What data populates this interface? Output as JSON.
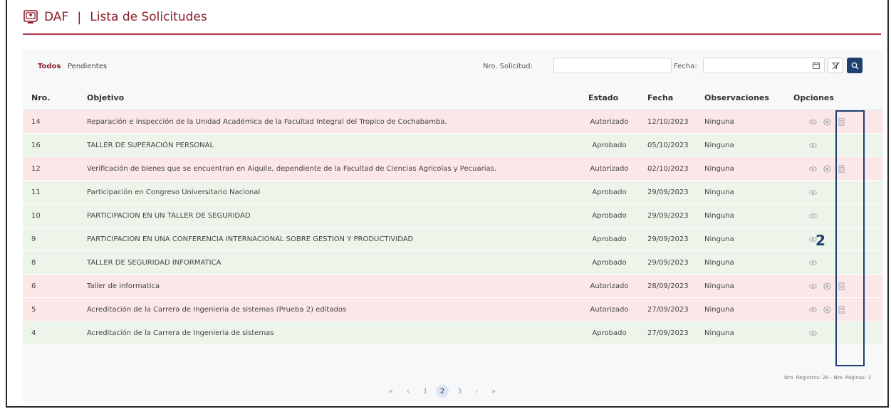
{
  "header": {
    "brand": "DAF",
    "separator": "|",
    "title": "Lista de Solicitudes"
  },
  "tabs": [
    {
      "label": "Todos",
      "active": true
    },
    {
      "label": "Pendientes",
      "active": false
    }
  ],
  "filters": {
    "nro_label": "Nro. Solicitud:",
    "nro_value": "",
    "fecha_label": "Fecha:",
    "fecha_value": ""
  },
  "table": {
    "headers": [
      "Nro.",
      "Objetivo",
      "Estado",
      "Fecha",
      "Observaciones",
      "Opciones"
    ],
    "rows": [
      {
        "nro": "14",
        "objetivo": "Reparación e inspección de la Unidad Académica de la Facultad Integral del Tropico de Cochabamba.",
        "estado": "Autorizado",
        "fecha": "12/10/2023",
        "obs": "Ninguna"
      },
      {
        "nro": "16",
        "objetivo": "TALLER DE SUPERACIÓN PERSONAL",
        "estado": "Aprobado",
        "fecha": "05/10/2023",
        "obs": "Ninguna"
      },
      {
        "nro": "12",
        "objetivo": "Verificación de bienes que se encuentran en Aiquile, dependiente de la Facultad de Ciencias Agricolas y Pecuarias.",
        "estado": "Autorizado",
        "fecha": "02/10/2023",
        "obs": "Ninguna"
      },
      {
        "nro": "11",
        "objetivo": "Participación en Congreso Universitario Nacional",
        "estado": "Aprobado",
        "fecha": "29/09/2023",
        "obs": "Ninguna"
      },
      {
        "nro": "10",
        "objetivo": "PARTICIPACION EN UN TALLER DE SEGURIDAD",
        "estado": "Aprobado",
        "fecha": "29/09/2023",
        "obs": "Ninguna"
      },
      {
        "nro": "9",
        "objetivo": "PARTICIPACION EN UNA CONFERENCIA INTERNACIONAL SOBRE GESTION Y PRODUCTIVIDAD",
        "estado": "Aprobado",
        "fecha": "29/09/2023",
        "obs": "Ninguna"
      },
      {
        "nro": "8",
        "objetivo": "TALLER DE SEGURIDAD INFORMATICA",
        "estado": "Aprobado",
        "fecha": "29/09/2023",
        "obs": "Ninguna"
      },
      {
        "nro": "6",
        "objetivo": "Taller de informatica",
        "estado": "Autorizado",
        "fecha": "28/09/2023",
        "obs": "Ninguna"
      },
      {
        "nro": "5",
        "objetivo": "Acreditación de la Carrera de Ingenieria de sistemas (Prueba 2) editados",
        "estado": "Autorizado",
        "fecha": "27/09/2023",
        "obs": "Ninguna"
      },
      {
        "nro": "4",
        "objetivo": "Acreditación de la Carrera de Ingenieria de sistemas",
        "estado": "Aprobado",
        "fecha": "27/09/2023",
        "obs": "Ninguna"
      }
    ]
  },
  "annotation": {
    "marker": "2"
  },
  "footer": {
    "records_text": "Nro. Registros: 26 - Nro. Páginas: 3"
  },
  "pagination": {
    "first": "«",
    "prev": "‹",
    "pages": [
      "1",
      "2",
      "3"
    ],
    "active_page": "2",
    "next": "›",
    "last": "»"
  },
  "colors": {
    "brand": "#8a1c2b",
    "accent": "#1f3f6e",
    "autorizado_row": "#fbe6e8",
    "aprobado_row": "#edf5ea"
  },
  "icons": {
    "view": "eye-icon",
    "cancel": "cancel-circle-icon",
    "document": "document-icon",
    "filter": "filter-off-icon",
    "search": "search-icon",
    "calendar": "calendar-icon",
    "logo": "monitor-logo-icon"
  }
}
